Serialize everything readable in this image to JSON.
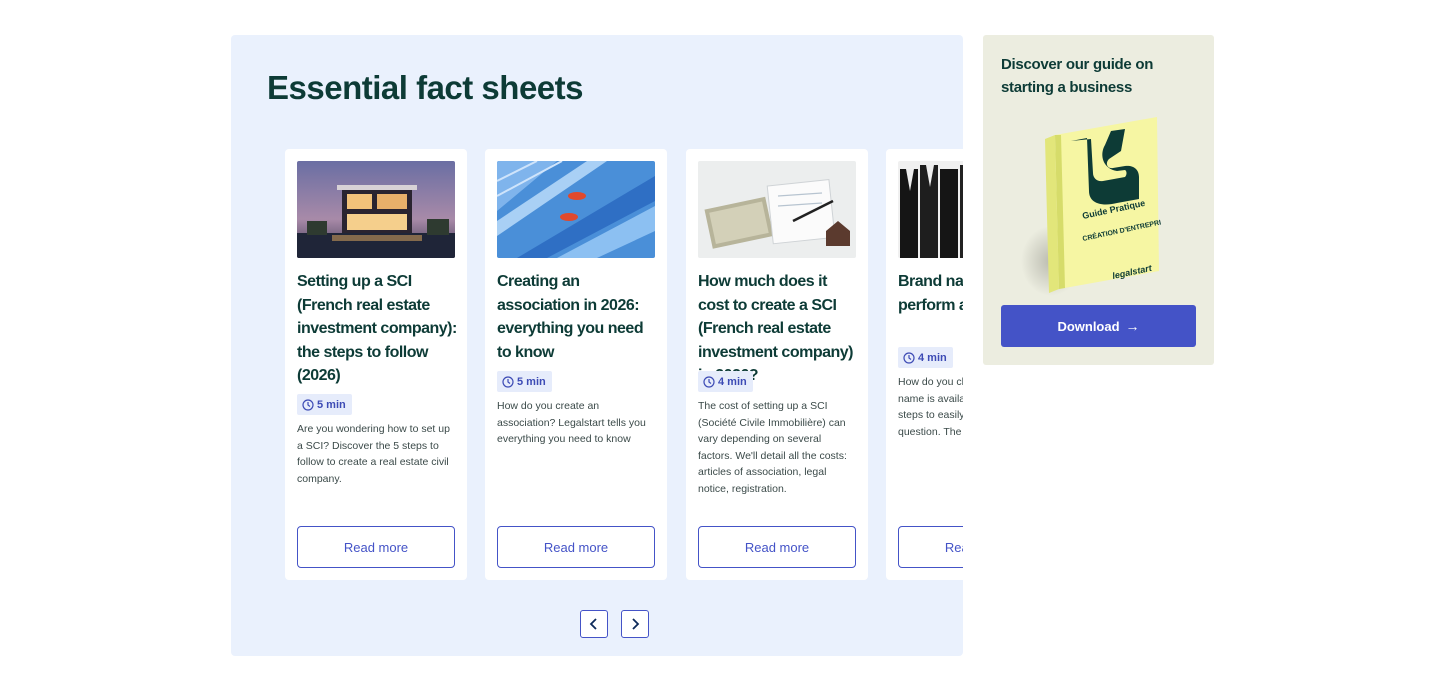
{
  "section": {
    "title": "Essential fact sheets"
  },
  "cards": [
    {
      "title": "Setting up a SCI (French real estate investment company): the steps to follow (2026)",
      "read_time": "5 min",
      "description": "Are you wondering how to set up a SCI? Discover the 5 steps to follow to create a real estate civil company.",
      "button": "Read more"
    },
    {
      "title": "Creating an association in 2026: everything you need to know",
      "read_time": "5 min",
      "description": "How do you create an association? Legalstart tells you everything you need to know",
      "button": "Read more"
    },
    {
      "title": "How much does it cost to create a SCI (French real estate investment company) in 2026?",
      "read_time": "4 min",
      "description": "The cost of setting up a SCI (Société Civile Immobilière) can vary depending on several factors. We'll detail all the costs: articles of association, legal notice, registration.",
      "button": "Read more"
    },
    {
      "title": "Brand name: how to perform a verification",
      "read_time": "4 min",
      "description": "How do you check if a brand name is available? Follow our steps to easily answer this question. The",
      "button": "Read more"
    }
  ],
  "guide": {
    "title": "Discover our guide on starting a business",
    "book_label_1": "Guide Pratique",
    "book_label_2": "CRÉATION D'ENTREPRISE",
    "book_brand": "legalstart",
    "button": "Download",
    "button_icon": "arrow-right-icon"
  },
  "nav": {
    "prev_icon": "chevron-left-icon",
    "next_icon": "chevron-right-icon"
  },
  "colors": {
    "panel_bg": "#eaf1fd",
    "side_bg": "#ecede0",
    "accent": "#4453c7",
    "title": "#0d3b36",
    "badge_bg": "#e6ecfb"
  }
}
